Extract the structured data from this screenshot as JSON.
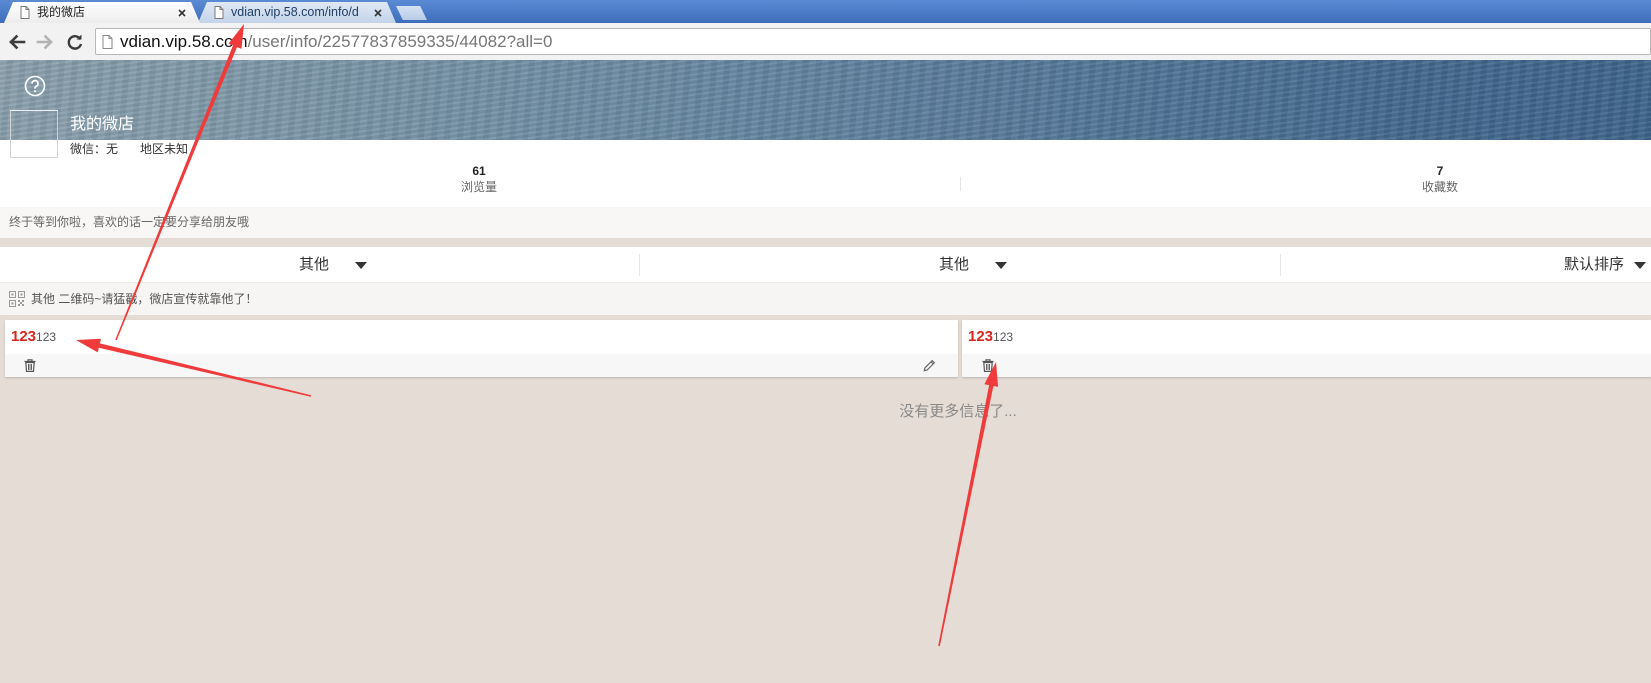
{
  "browser": {
    "tabs": [
      {
        "title": "我的微店",
        "active": true
      },
      {
        "title": "vdian.vip.58.com/info/d",
        "active": false
      }
    ],
    "address": {
      "host": "vdian.vip.58.com",
      "path": "/user/info/22577837859335/44082?all=0"
    }
  },
  "shop": {
    "name": "我的微店",
    "wechat": "微信：无",
    "region": "地区未知"
  },
  "stats": [
    {
      "value": "61",
      "label": "浏览量"
    },
    {
      "value": "7",
      "label": "收藏数"
    }
  ],
  "description": "终于等到你啦，喜欢的话一定要分享给朋友哦",
  "filters": [
    "其他",
    "其他",
    "默认排序"
  ],
  "qr_notice": "其他 二维码~请猛戳，微店宣传就靠他了！",
  "items": [
    {
      "highlight": "123",
      "text": "123"
    },
    {
      "highlight": "123",
      "text": "123"
    }
  ],
  "end_text": "没有更多信息了...",
  "icons": {
    "tab": "page-icon",
    "tab_close": "close-icon",
    "back": "back-arrow-icon",
    "forward": "forward-arrow-icon",
    "reload": "reload-icon",
    "help": "question-circle-icon",
    "qr": "qr-code-icon",
    "delete": "trash-icon",
    "edit": "pencil-icon"
  },
  "colors": {
    "accent": "#d8261c",
    "tabbar": "#4a7cc8",
    "banner": "#587b9c",
    "page_bg": "#e5ddd5",
    "annotation": "#ef3b3b"
  }
}
